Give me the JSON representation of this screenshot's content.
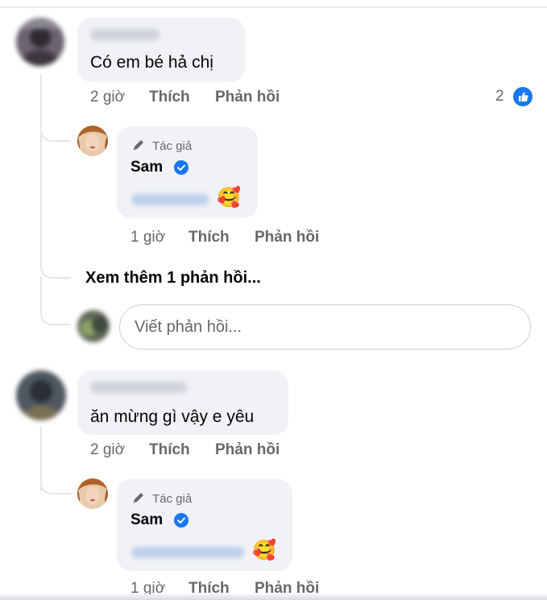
{
  "comments": [
    {
      "text": "Có em bé hả chị",
      "time": "2 giờ",
      "like": "Thích",
      "reply": "Phản hồi",
      "reaction_count": "2",
      "reaction_icon": "like-icon",
      "author_reply": {
        "author_tag": "Tác giả",
        "name": "Sam",
        "emoji": "🥰",
        "time": "1 giờ",
        "like": "Thích",
        "reply": "Phản hồi"
      },
      "see_more": "Xem thêm 1 phản hồi...",
      "reply_placeholder": "Viết phản hồi..."
    },
    {
      "text": "ăn mừng gì vậy e yêu",
      "time": "2 giờ",
      "like": "Thích",
      "reply": "Phản hồi",
      "author_reply": {
        "author_tag": "Tác giả",
        "name": "Sam",
        "emoji": "🥰",
        "time": "1 giờ",
        "like": "Thích",
        "reply": "Phản hồi"
      }
    }
  ],
  "colors": {
    "accent": "#1877f2",
    "bubble": "#f0f2f5",
    "meta_text": "#65676b",
    "thread_line": "#e4e6eb"
  }
}
